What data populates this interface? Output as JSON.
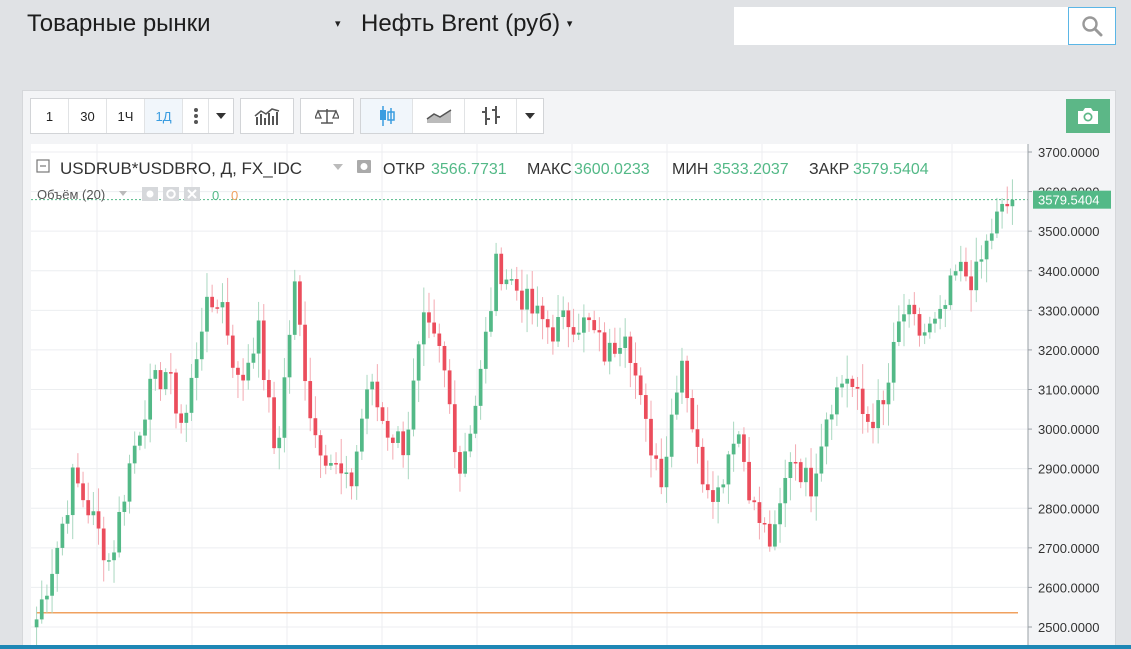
{
  "header": {
    "market_label": "Товарные рынки",
    "instrument_label": "Нефть Brent (руб)",
    "caret": "▾",
    "search_placeholder": ""
  },
  "toolbar": {
    "timeframes": [
      "1",
      "30",
      "1Ч",
      "1Д"
    ],
    "active_timeframe": "1Д",
    "more_icon": "more-vertical-icon"
  },
  "legend": {
    "symbol": "USDRUB*USDBRO, Д, FX_IDC",
    "open_label": "ОТКР",
    "open_value": "3566.7731",
    "high_label": "МАКС",
    "high_value": "3600.0233",
    "low_label": "МИН",
    "low_value": "3533.2037",
    "close_label": "ЗАКР",
    "close_value": "3579.5404",
    "volume_label": "Объём (20)",
    "volume_v1": "0",
    "volume_v2": "0"
  },
  "colors": {
    "up": "#53b987",
    "down": "#eb4d5c",
    "price_line": "#53b987",
    "volume_line": "#f0a15f",
    "axis_text": "#333333",
    "accent": "#3b9de0"
  },
  "chart_data": {
    "type": "candlestick",
    "y_ticks": [
      "2500.0000",
      "2600.0000",
      "2700.0000",
      "2800.0000",
      "2900.0000",
      "3000.0000",
      "3100.0000",
      "3200.0000",
      "3300.0000",
      "3400.0000",
      "3500.0000",
      "3600.0000",
      "3700.0000"
    ],
    "ylim": [
      2480,
      3720
    ],
    "last_price": 3579.5404,
    "last_price_label": "3579.5404",
    "volume_level": 2536,
    "grid": true,
    "close_series": [
      2520,
      2680,
      2880,
      2780,
      2660,
      2900,
      3080,
      3150,
      3000,
      3280,
      3340,
      3100,
      3260,
      2920,
      3360,
      3000,
      2920,
      2840,
      3120,
      3000,
      2960,
      3260,
      3180,
      2900,
      3100,
      3420,
      3360,
      3290,
      3250,
      3280,
      3260,
      3180,
      3270,
      3010,
      2880,
      3200,
      2900,
      2840,
      3020,
      2790,
      2700,
      2950,
      2850,
      3060,
      3140,
      3020,
      3050,
      3300,
      3240,
      3260,
      3400,
      3380,
      3520,
      3579.54
    ]
  }
}
